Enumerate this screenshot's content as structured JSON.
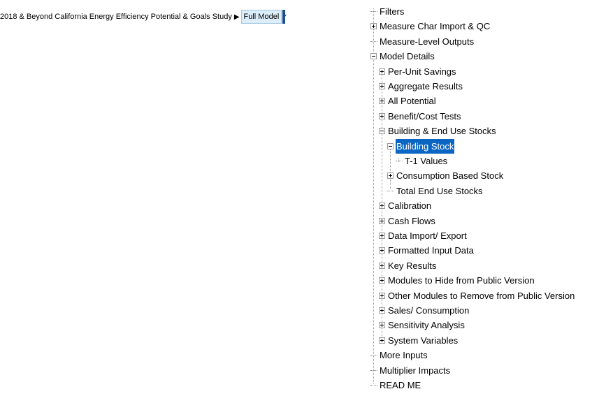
{
  "breadcrumb": {
    "path": "2018 & Beyond California Energy Efficiency Potential & Goals Study",
    "current": "Full Model"
  },
  "tree": [
    {
      "label": "Filters",
      "level": 0,
      "toggle": "none"
    },
    {
      "label": "Measure Char Import & QC",
      "level": 0,
      "toggle": "plus"
    },
    {
      "label": "Measure-Level Outputs",
      "level": 0,
      "toggle": "none"
    },
    {
      "label": "Model Details",
      "level": 0,
      "toggle": "minus"
    },
    {
      "label": " Per-Unit Savings",
      "level": 1,
      "toggle": "plus"
    },
    {
      "label": "Aggregate Results",
      "level": 1,
      "toggle": "plus"
    },
    {
      "label": "All Potential",
      "level": 1,
      "toggle": "plus"
    },
    {
      "label": "Benefit/Cost Tests",
      "level": 1,
      "toggle": "plus"
    },
    {
      "label": "Building & End Use Stocks",
      "level": 1,
      "toggle": "minus"
    },
    {
      "label": "Building Stock",
      "level": 2,
      "toggle": "minus",
      "selected": true
    },
    {
      "label": "T-1 Values",
      "level": 3,
      "toggle": "none"
    },
    {
      "label": "Consumption Based Stock",
      "level": 2,
      "toggle": "plus"
    },
    {
      "label": "Total End Use Stocks",
      "level": 2,
      "toggle": "none"
    },
    {
      "label": "Calibration",
      "level": 1,
      "toggle": "plus"
    },
    {
      "label": "Cash Flows",
      "level": 1,
      "toggle": "plus"
    },
    {
      "label": "Data Import/ Export",
      "level": 1,
      "toggle": "plus"
    },
    {
      "label": "Formatted Input Data",
      "level": 1,
      "toggle": "plus"
    },
    {
      "label": "Key Results",
      "level": 1,
      "toggle": "plus"
    },
    {
      "label": "Modules to Hide from Public Version",
      "level": 1,
      "toggle": "plus"
    },
    {
      "label": "Other Modules to Remove from Public Version",
      "level": 1,
      "toggle": "plus"
    },
    {
      "label": "Sales/ Consumption",
      "level": 1,
      "toggle": "plus"
    },
    {
      "label": "Sensitivity Analysis",
      "level": 1,
      "toggle": "plus"
    },
    {
      "label": "System Variables",
      "level": 1,
      "toggle": "plus"
    },
    {
      "label": "More Inputs",
      "level": 0,
      "toggle": "none"
    },
    {
      "label": "Multiplier Impacts",
      "level": 0,
      "toggle": "none"
    },
    {
      "label": "READ ME",
      "level": 0,
      "toggle": "none"
    }
  ]
}
